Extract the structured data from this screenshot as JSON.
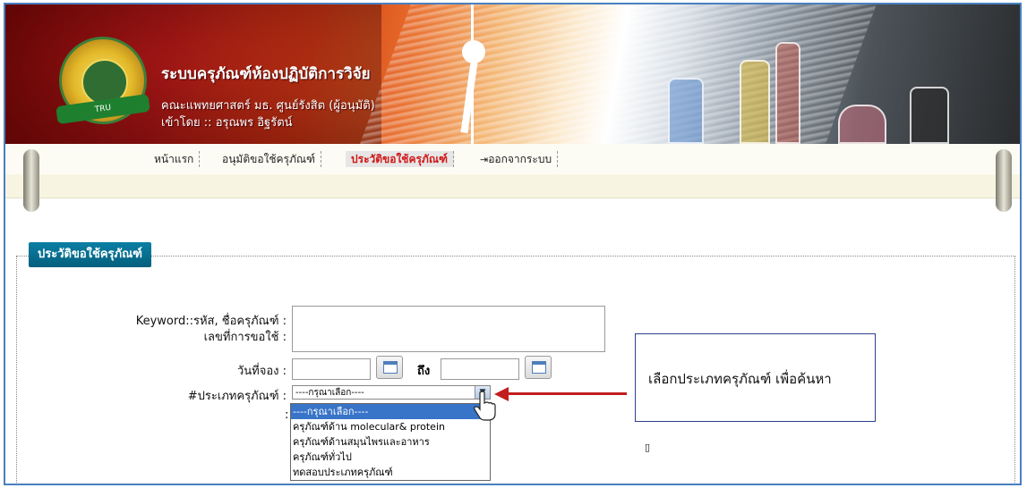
{
  "header": {
    "title": "ระบบครุภัณฑ์ห้องปฏิบัติการวิจัย",
    "subtitle": "คณะแพทยศาสตร์ มธ. ศูนย์รังสิต (ผู้อนุมัติ)",
    "user": "เข้าโดย :: อรุณพร อิฐรัตน์",
    "logo_text": "TRU"
  },
  "nav": {
    "items": [
      {
        "label": "หน้าแรก"
      },
      {
        "label": "อนุมัติขอใช้ครุภัณฑ์"
      },
      {
        "label": "ประวัติขอใช้ครุภัณฑ์"
      },
      {
        "label": "ออกจากระบบ"
      }
    ]
  },
  "panel": {
    "legend": "ประวัติขอใช้ครุภัณฑ์",
    "keyword_label": "Keyword::รหัส, ชื่อครุภัณฑ์ :",
    "request_no_label": "เลขที่การขอใช้ :",
    "date_label": "วันที่จอง :",
    "to_label": "ถึง",
    "type_label": "#ประเภทครุภัณฑ์ :",
    "colon": ":",
    "select_value": "----กรุณาเลือก----",
    "options": [
      "----กรุณาเลือก----",
      "ครุภัณฑ์ด้าน molecular& protein",
      "ครุภัณฑ์ด้านสมุนไพรและอาหาร",
      "ครุภัณฑ์ทั่วไป",
      "ทดสอบประเภทครุภัณฑ์"
    ]
  },
  "callout": {
    "text": "เลือกประเภทครุภัณฑ์ เพื่อค้นหา"
  },
  "misc": {
    "mark": "▯"
  },
  "colors": {
    "accent": "#0b7fa4",
    "active_nav": "#d01818",
    "arrow": "#c31d1d",
    "border": "#4a7fc0"
  }
}
